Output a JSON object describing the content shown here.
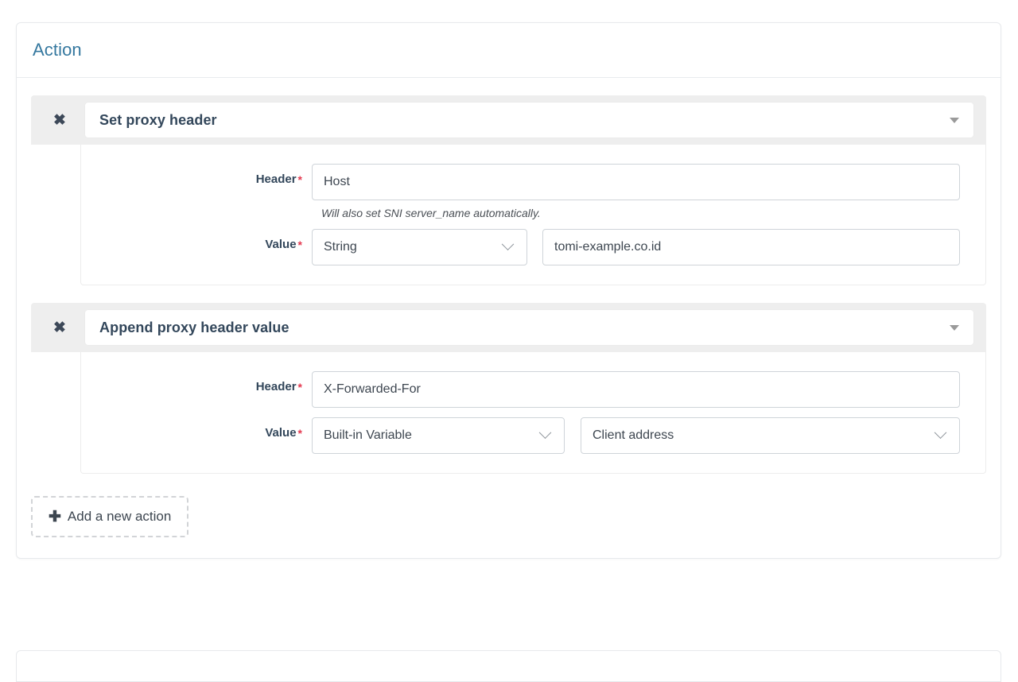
{
  "card": {
    "title": "Action"
  },
  "actions": [
    {
      "remove_icon": "close-icon",
      "remove_glyph": "✖",
      "type_label": "Set proxy header",
      "caret_icon": "caret-down-icon",
      "fields": {
        "header_label": "Header",
        "header_required": "*",
        "header_value": "Host",
        "header_help": "Will also set SNI server_name automatically.",
        "value_label": "Value",
        "value_required": "*",
        "value_type": "String",
        "value_content": "tomi-example.co.id"
      }
    },
    {
      "remove_icon": "close-icon",
      "remove_glyph": "✖",
      "type_label": "Append proxy header value",
      "caret_icon": "caret-down-icon",
      "fields": {
        "header_label": "Header",
        "header_required": "*",
        "header_value": "X-Forwarded-For",
        "value_label": "Value",
        "value_required": "*",
        "value_type": "Built-in Variable",
        "value_content": "Client address"
      }
    }
  ],
  "add_action": {
    "icon": "plus-icon",
    "glyph": "✚",
    "label": "Add a new action"
  },
  "colors": {
    "title_blue": "#35789f",
    "required_red": "#e4384f",
    "header_strip_gray": "#eeeeee",
    "label_dark": "#33475b",
    "border_gray": "#cfd4d9"
  }
}
